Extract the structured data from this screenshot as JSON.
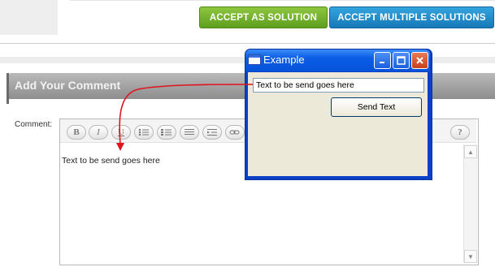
{
  "actions": {
    "accept_solution": "ACCEPT AS SOLUTION",
    "accept_multiple": "ACCEPT MULTIPLE SOLUTIONS"
  },
  "comment": {
    "header": "Add Your Comment",
    "label": "Comment:",
    "editor_text": "Text to be send goes here",
    "toolbar_icons": [
      "bold-icon",
      "italic-icon",
      "underline-icon",
      "bullet-list-icon",
      "numbered-list-icon",
      "align-icon",
      "indent-icon",
      "link-icon",
      "help-icon"
    ],
    "help_label": "?"
  },
  "window": {
    "title": "Example",
    "input_value": "Text to be send goes here",
    "send_label": "Send Text"
  },
  "colors": {
    "accept_green": "#6aab25",
    "accept_blue": "#1f87c9",
    "arrow_red": "#e0141e",
    "xp_title_blue": "#0a5ce6"
  }
}
